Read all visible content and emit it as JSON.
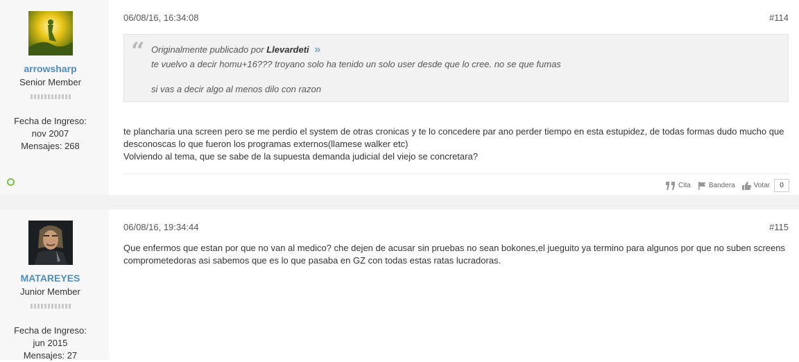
{
  "posts": [
    {
      "username": "arrowsharp",
      "user_title": "Senior Member",
      "join_label": "Fecha de Ingreso:",
      "join_date": "nov 2007",
      "posts_label": "Mensajes:",
      "posts_count": "268",
      "date": "06/08/16, 16:34:08",
      "post_number": "#114",
      "quote": {
        "intro": "Originalmente publicado por",
        "author": "Llevardeti",
        "lines": [
          "te vuelvo a decir homu+16??? troyano solo ha tenido un solo user desde que lo cree. no se que fumas",
          "si vas a decir algo al menos dilo con razon"
        ]
      },
      "message": [
        "te plancharia una screen pero se me perdio el system de otras cronicas y te lo concedere par ano perder tiempo en esta estupidez, de todas formas dudo mucho que desconoscas lo que fueron los programas externos(llamese walker etc)",
        "Volviendo al tema, que se sabe de la supuesta demanda judicial del viejo se concretara?"
      ],
      "actions": {
        "quote": "Cita",
        "flag": "Bandera",
        "vote": "Votar",
        "vote_count": "0"
      }
    },
    {
      "username": "MATAREYES",
      "user_title": "Junior Member",
      "join_label": "Fecha de Ingreso:",
      "join_date": "jun 2015",
      "posts_label": "Mensajes:",
      "posts_count": "27",
      "date": "06/08/16, 19:34:44",
      "post_number": "#115",
      "message": [
        "Que enfermos que estan por que no van al medico? che dejen de acusar sin pruebas no sean bokones,el jueguito ya termino para algunos por que no suben screens comprometedoras asi sabemos que es lo que pasaba en GZ con todas estas ratas lucradoras."
      ]
    }
  ],
  "colors": {
    "username": "#4f8cc0",
    "online": "#7cc242",
    "sidebar": "#f7f7f7"
  },
  "icons": [
    "avatar",
    "quote-mark-icon",
    "quote-arrow-icon",
    "online-status-icon",
    "quote-icon",
    "flag-icon",
    "thumbs-up-icon"
  ]
}
